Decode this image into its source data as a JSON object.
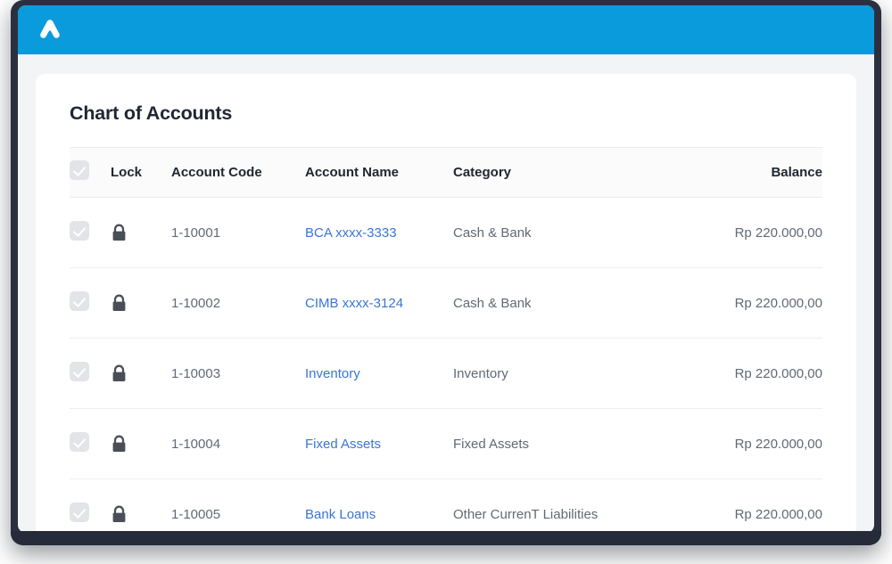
{
  "app": {
    "bar_color": "#0a9bdc",
    "logo_icon": "accurate-chevron-logo"
  },
  "page": {
    "title": "Chart of Accounts"
  },
  "table": {
    "columns": {
      "select_all": "",
      "lock": "Lock",
      "account_code": "Account Code",
      "account_name": "Account Name",
      "category": "Category",
      "balance": "Balance"
    },
    "header_checkbox_checked": true,
    "rows": [
      {
        "checked": true,
        "lock_icon": "lock-closed-icon",
        "account_code": "1-10001",
        "account_name": "BCA xxxx-3333",
        "category": "Cash & Bank",
        "balance": "Rp 220.000,00"
      },
      {
        "checked": true,
        "lock_icon": "lock-closed-icon",
        "account_code": "1-10002",
        "account_name": "CIMB xxxx-3124",
        "category": "Cash & Bank",
        "balance": "Rp 220.000,00"
      },
      {
        "checked": true,
        "lock_icon": "lock-closed-icon",
        "account_code": "1-10003",
        "account_name": "Inventory",
        "category": "Inventory",
        "balance": "Rp 220.000,00"
      },
      {
        "checked": true,
        "lock_icon": "lock-closed-icon",
        "account_code": "1-10004",
        "account_name": "Fixed Assets",
        "category": "Fixed Assets",
        "balance": "Rp 220.000,00"
      },
      {
        "checked": true,
        "lock_icon": "lock-closed-icon",
        "account_code": "1-10005",
        "account_name": "Bank Loans",
        "category": "Other CurrenT Liabilities",
        "balance": "Rp 220.000,00"
      }
    ]
  },
  "colors": {
    "accent_blue": "#0a9bdc",
    "link_blue": "#3b74d6",
    "text_dark": "#1f2733",
    "text_muted": "#5c6470",
    "checkbox_gray": "#e2e4e7",
    "lock_gray": "#4a4f57",
    "frame_dark": "#2b3040"
  }
}
